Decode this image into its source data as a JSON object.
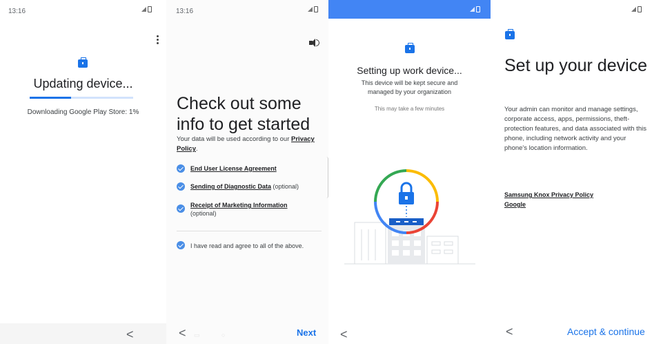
{
  "screen1": {
    "time": "13:16",
    "title": "Updating device...",
    "progress_fraction": 0.4,
    "message": "Downloading Google Play Store: 1%",
    "back": "<"
  },
  "screen2": {
    "time": "13:16",
    "title": "Check out some info to get started",
    "intro_prefix": "Your data will be used according to our ",
    "intro_link": "Privacy Policy",
    "intro_suffix": ".",
    "items": [
      {
        "link": "End User License Agreement",
        "suffix": ""
      },
      {
        "link": "Sending of Diagnostic Data",
        "suffix": " (optional)"
      },
      {
        "link": "Receipt of Marketing Information",
        "suffix": " (optional)"
      }
    ],
    "agree": "I have read and agree to all of the above.",
    "back": "<",
    "next": "Next"
  },
  "screen3": {
    "title": "Setting up work device...",
    "subtitle": "This device will be kept secure and managed by your organization",
    "note": "This may take a few minutes",
    "back": "<"
  },
  "screen4": {
    "title": "Set up your device",
    "body": "Your admin can monitor and manage settings, corporate access, apps, permissions, theft-protection features, and data associated with this phone, including network activity and your phone's location information.",
    "link1": "Samsung Knox Privacy Policy",
    "link2": "Google",
    "back": "<",
    "accept": "Accept & continue"
  },
  "icons": {
    "briefcase": "briefcase-icon",
    "speaker": "speaker-icon",
    "lock": "lock-icon",
    "check": "check-circle-icon"
  },
  "colors": {
    "accent": "#1a73e8",
    "check": "#4a8ee6",
    "topbar": "#4285f4"
  }
}
